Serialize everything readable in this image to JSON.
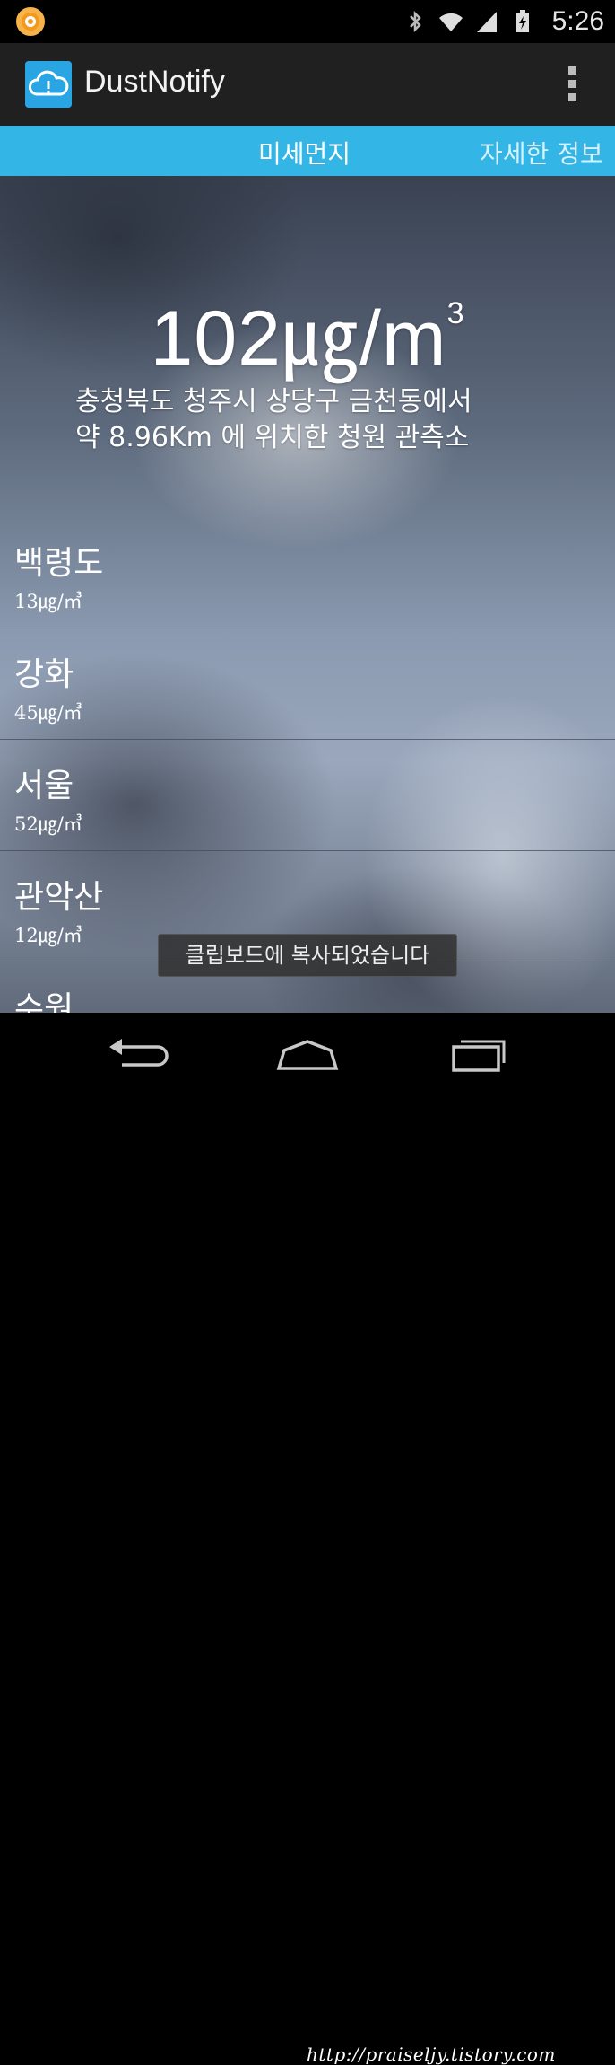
{
  "status_bar": {
    "time": "5:26"
  },
  "app": {
    "title": "DustNotify"
  },
  "tabs": [
    {
      "label": "미세먼지"
    },
    {
      "label": "자세한 정보"
    }
  ],
  "main": {
    "value": "102",
    "unit": "㎍/m",
    "unit_sup": "3",
    "location_line1": "충청북도 청주시 상당구 금천동에서",
    "location_line2": "약 8.96Km 에 위치한 청원 관측소"
  },
  "stations": [
    {
      "name": "백령도",
      "value": "13㎍/㎥"
    },
    {
      "name": "강화",
      "value": "45㎍/㎥"
    },
    {
      "name": "서울",
      "value": "52㎍/㎥"
    },
    {
      "name": "관악산",
      "value": "12㎍/㎥"
    },
    {
      "name": "수원",
      "value": ""
    }
  ],
  "toast": "클립보드에 복사되었습니다",
  "watermark": "http://praiseljy.tistory.com",
  "colors": {
    "tab_bar": "#33b5e5",
    "app_icon": "#2aa5e4",
    "action_bar": "#202020"
  }
}
